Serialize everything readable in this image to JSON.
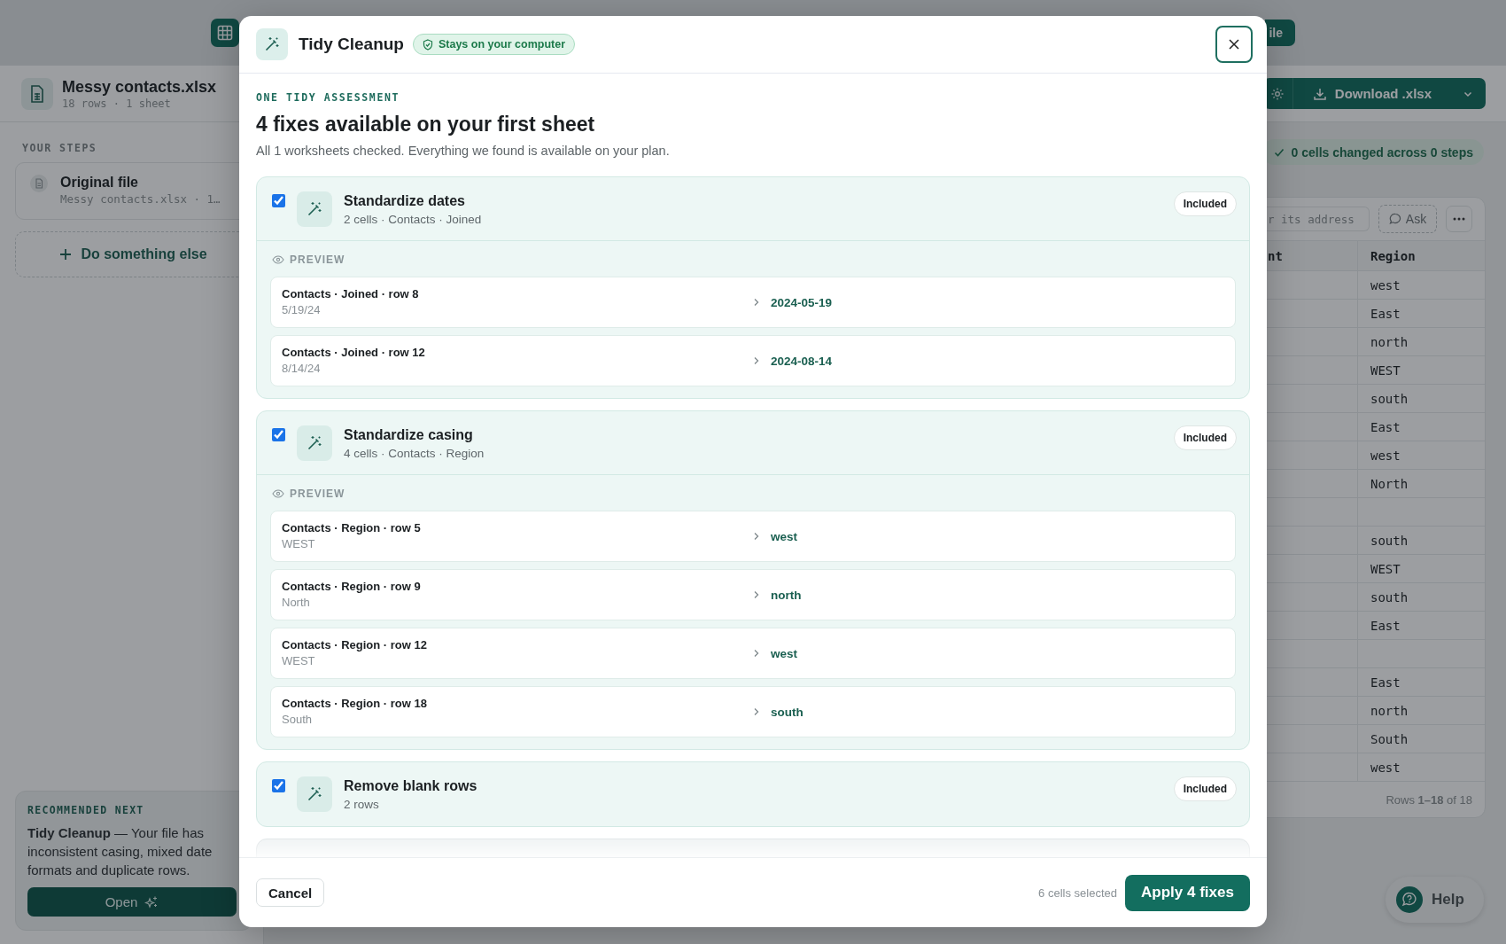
{
  "top_bar": {
    "partial_button": "ile"
  },
  "file": {
    "name": "Messy contacts.xlsx",
    "meta": "18 rows · 1 sheet"
  },
  "toolbar": {
    "download_label": "Download .xlsx"
  },
  "sidebar": {
    "steps_heading": "YOUR STEPS",
    "steps": [
      {
        "title": "Original file",
        "subtitle": "Messy contacts.xlsx · 1…"
      }
    ],
    "add_step": "Do something else",
    "recommended": {
      "eyebrow": "RECOMMENDED NEXT",
      "text": "**Tidy Cleanup** — Your file has inconsistent casing, mixed date formats and duplicate rows.",
      "button": "Open"
    }
  },
  "status": "0 cells changed across 0 steps",
  "table": {
    "search_placeholder": "r its address",
    "ask_button": "Ask",
    "columns": [
      "nt",
      "Region"
    ],
    "rows": [
      {
        "region": "west"
      },
      {
        "region": "East"
      },
      {
        "region": "north"
      },
      {
        "region": "WEST"
      },
      {
        "region": "south"
      },
      {
        "region": "East"
      },
      {
        "region": "west"
      },
      {
        "region": "North"
      },
      {},
      {
        "region": "south"
      },
      {
        "region": "WEST"
      },
      {
        "region": "south"
      },
      {
        "region": "East"
      },
      {},
      {
        "region": "East"
      },
      {
        "region": "north"
      },
      {
        "region": "South"
      },
      {
        "region": "west"
      }
    ],
    "footer": "Rows **1–18** of 18"
  },
  "help_button": "Help",
  "dialog": {
    "title": "Tidy Cleanup",
    "badge": "Stays on your computer",
    "eyebrow": "ONE TIDY ASSESSMENT",
    "heading": "4 fixes available on your first sheet",
    "summary": "All 1 worksheets checked. Everything we found is available on your plan.",
    "fixes": [
      {
        "title": "Standardize dates",
        "detail": "2 cells · Contacts · Joined",
        "checked": true,
        "status": "Included",
        "preview_label": "PREVIEW",
        "previews": [
          {
            "location": "Contacts · Joined · row 8",
            "before": "5/19/24",
            "after": "2024-05-19"
          },
          {
            "location": "Contacts · Joined · row 12",
            "before": "8/14/24",
            "after": "2024-08-14"
          }
        ]
      },
      {
        "title": "Standardize casing",
        "detail": "4 cells · Contacts · Region",
        "checked": true,
        "status": "Included",
        "preview_label": "PREVIEW",
        "previews": [
          {
            "location": "Contacts · Region · row 5",
            "before": "WEST",
            "after": "west"
          },
          {
            "location": "Contacts · Region · row 9",
            "before": "North",
            "after": "north"
          },
          {
            "location": "Contacts · Region · row 12",
            "before": "WEST",
            "after": "west"
          },
          {
            "location": "Contacts · Region · row 18",
            "before": "South",
            "after": "south"
          }
        ]
      },
      {
        "title": "Remove blank rows",
        "detail": "2 rows",
        "checked": true,
        "status": "Included"
      }
    ],
    "cancel": "Cancel",
    "selection": "6 cells selected",
    "apply": "Apply 4 fixes"
  }
}
